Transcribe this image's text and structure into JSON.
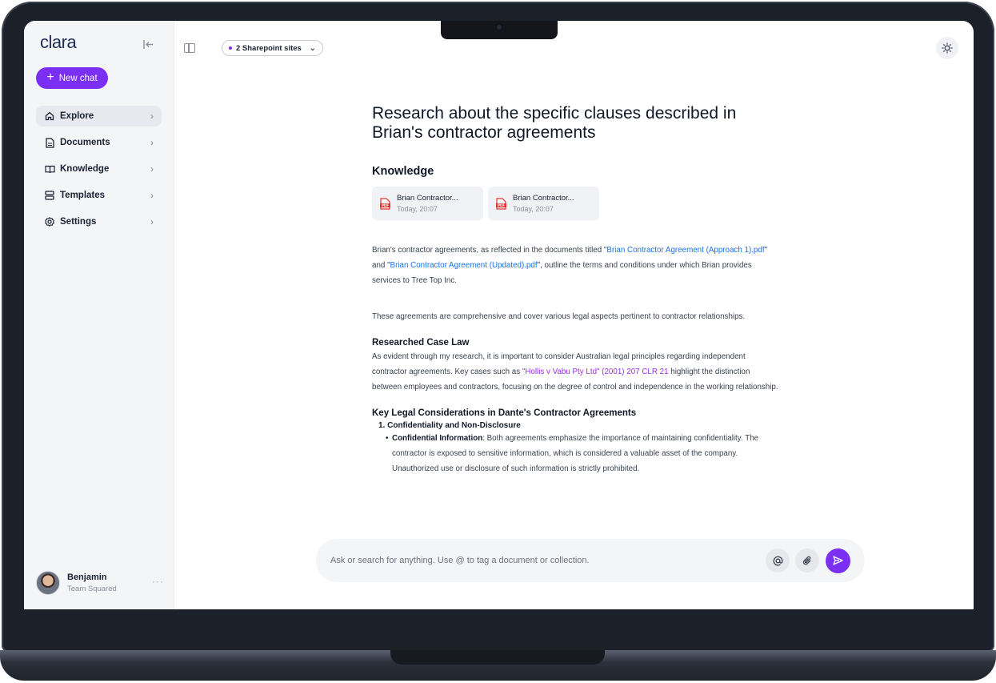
{
  "app": {
    "logo": "clara"
  },
  "sidebar": {
    "new_chat_label": "New chat",
    "items": [
      {
        "label": "Explore",
        "icon": "home-icon",
        "active": true
      },
      {
        "label": "Documents",
        "icon": "document-icon",
        "active": false
      },
      {
        "label": "Knowledge",
        "icon": "book-icon",
        "active": false
      },
      {
        "label": "Templates",
        "icon": "templates-icon",
        "active": false
      },
      {
        "label": "Settings",
        "icon": "gear-icon",
        "active": false
      }
    ],
    "user": {
      "name": "Benjamin",
      "team": "Team Squared"
    }
  },
  "topbar": {
    "sources_label": "2 Sharepoint sites"
  },
  "main": {
    "title": "Research about the specific clauses described in Brian's contractor agreements",
    "knowledge_heading": "Knowledge",
    "files": [
      {
        "name": "Brian Contractor...",
        "date": "Today, 20:07",
        "icon": "pdf-icon"
      },
      {
        "name": "Brian Contractor...",
        "date": "Today, 20:07",
        "icon": "pdf-icon"
      }
    ],
    "p1_a": "Brian's contractor agreements, as reflected in the documents titled \"",
    "p1_link1": "Brian Contractor Agreement (Approach 1).pdf",
    "p1_b": "\" and \"",
    "p1_link2": "Brian Contractor Agreement (Updated).pdf",
    "p1_c": "\", outline the terms and conditions under which Brian provides services to Tree Top Inc.",
    "p2": "These agreements are comprehensive and cover various legal aspects pertinent to contractor relationships.",
    "case_law_heading": "Researched Case Law",
    "p3_a": "As evident through my research, it is important to consider Australian legal principles regarding independent contractor agreements. Key cases such as ",
    "p3_link": "\"Hollis v Vabu Pty Ltd\" (2001) 207 CLR 21",
    "p3_b": " highlight the distinction between employees and contractors, focusing on the degree of control and independence in the working relationship.",
    "considerations_heading": "Key Legal Considerations in Dante's Contractor Agreements",
    "list_item_1": "1. Confidentiality and Non-Disclosure",
    "bullet_1_label": "Confidential Information",
    "bullet_1_text": ": Both agreements emphasize the importance of maintaining confidentiality. The contractor is exposed to sensitive information, which is considered a valuable asset of the company. Unauthorized use or disclosure of such information is strictly prohibited."
  },
  "composer": {
    "placeholder": "Ask or search for anything. Use @ to tag a document or collection."
  },
  "colors": {
    "accent": "#7b2ff2",
    "link": "#1a73e8",
    "case_link": "#9b30e0"
  }
}
